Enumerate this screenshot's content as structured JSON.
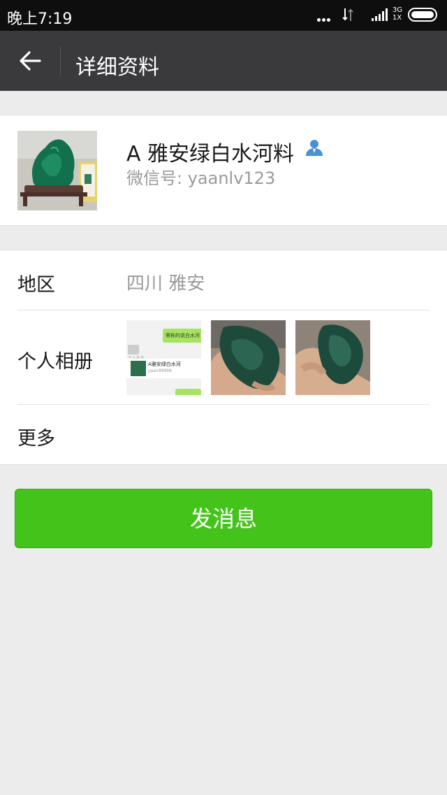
{
  "status_bar": {
    "time": "晚上7:19",
    "network_type": "3G",
    "sim_slot": "1X",
    "icons": [
      "more-dots-icon",
      "data-transfer-icon",
      "signal-icon",
      "battery-icon"
    ]
  },
  "navbar": {
    "title": "详细资料",
    "back_icon": "back-arrow-icon"
  },
  "profile": {
    "name": "A  雅安绿白水河料",
    "wechat_id": "微信号: yaanlv123",
    "contact_icon": "contact-person-icon"
  },
  "details": {
    "region_label": "地区",
    "region_value": "四川  雅安",
    "album_label": "个人相册",
    "album_thumbs": [
      {
        "bubble_text": "荣栎的说白水河",
        "card_header": "个人名片",
        "card_title": "A雅安绿白水河",
        "card_id": "yaan99999"
      },
      {},
      {}
    ],
    "more_label": "更多"
  },
  "send_button": {
    "label": "发消息"
  },
  "colors": {
    "status_bar_bg": "#0e0e0e",
    "navbar_bg": "#3a3a3d",
    "page_bg": "#ececec",
    "primary_button": "#44c41a",
    "secondary_text": "#9a9a9a",
    "contact_icon_blue": "#4a90d9"
  }
}
